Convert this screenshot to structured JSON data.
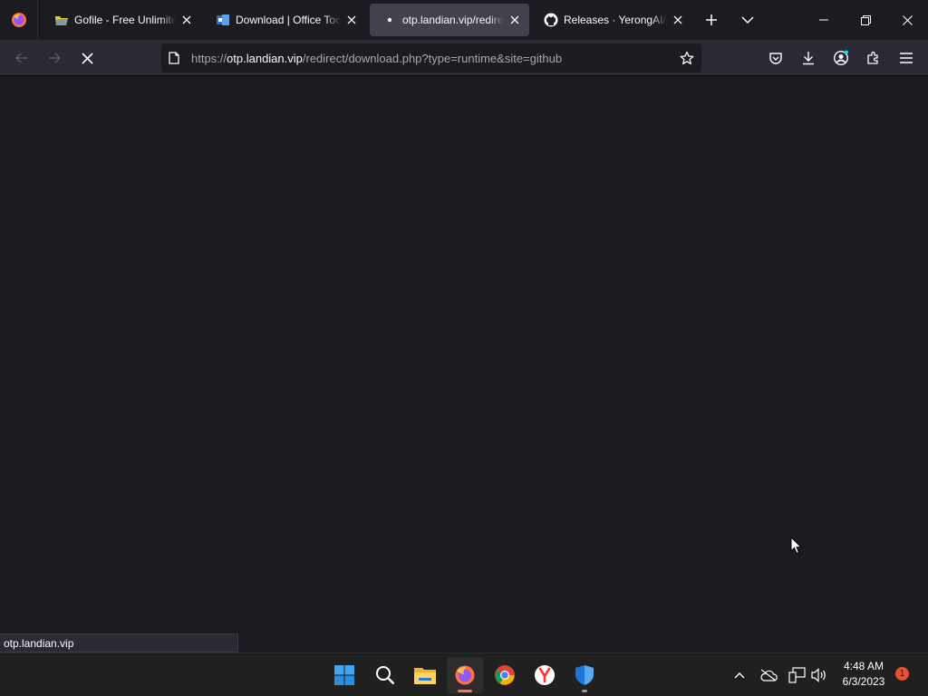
{
  "browser": {
    "tabs": [
      {
        "title": "Gofile - Free Unlimited",
        "favicon": "gofile-icon",
        "active": false
      },
      {
        "title": "Download | Office Tool",
        "favicon": "office-tool-icon",
        "active": false
      },
      {
        "title": "otp.landian.vip/redirect",
        "favicon": "loading-dot-icon",
        "active": true
      },
      {
        "title": "Releases · YerongAI/Offi",
        "favicon": "github-icon",
        "active": false
      }
    ],
    "url": {
      "scheme": "https://",
      "host": "otp.landian.vip",
      "path": "/redirect/download.php?type=runtime&site=github"
    },
    "status_text": "otp.landian.vip"
  },
  "taskbar": {
    "apps": [
      "start-icon",
      "search-icon",
      "file-explorer-icon",
      "firefox-icon",
      "chrome-icon",
      "yandex-icon",
      "windows-security-icon"
    ],
    "clock": {
      "time": "4:48 AM",
      "date": "6/3/2023"
    },
    "notification_count": "1"
  },
  "colors": {
    "accent": "#ff6f61",
    "tab_active": "#42414d",
    "toolbar": "#2b2a33",
    "content_bg": "#1c1b22"
  }
}
